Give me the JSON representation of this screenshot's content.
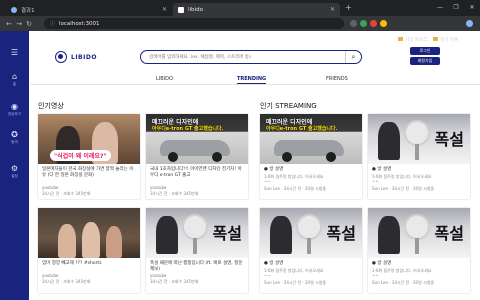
{
  "browser": {
    "tabs": [
      {
        "label": "결과1",
        "active": false
      },
      {
        "label": "libido",
        "active": true
      }
    ],
    "url": "localhost:3001",
    "bookmarks": [
      "기타 북마크",
      "읽기 목록"
    ]
  },
  "header": {
    "logo": "LIBIDO",
    "search_placeholder": "검색어를 입력하세요. (ex. 채널명, 제목, 스트리머 등)",
    "login_label": "로그인",
    "signup_label": "회원가입"
  },
  "sidebar": {
    "items": [
      {
        "icon": "menu-icon",
        "label": ""
      },
      {
        "icon": "home-icon",
        "label": "홈"
      },
      {
        "icon": "broadcast-icon",
        "label": "방송하기"
      },
      {
        "icon": "explore-icon",
        "label": "탐색"
      },
      {
        "icon": "settings-icon",
        "label": "설정"
      }
    ]
  },
  "nav": {
    "tabs": [
      {
        "label": "LIBIDO",
        "active": false
      },
      {
        "label": "TRENDING",
        "active": true
      },
      {
        "label": "FRIENDS",
        "active": false
      }
    ]
  },
  "sections": {
    "videos_title": "인기영상",
    "streaming_title": "인기 STREAMING"
  },
  "videos": [
    {
      "title": "일본여자들이 한국 화장실에 가면 깜짝 놀라는 이유 (다 한 일본 화장실 문화)",
      "channel": "youtube",
      "meta": "34시간 전 · 조회수 345만회",
      "caption": "\"식겁이 왜 이래요?\""
    },
    {
      "title": "국내 1호차입니다!!! 아이언맨 디자인 전기차! 아우디 e-tron GT 출고",
      "channel": "youtube",
      "meta": "34시간 전 · 조회수 345만회",
      "caption1": "매끄러운 디자인에",
      "caption2": "아우디e-tron GT 출고했습니다."
    },
    {
      "title": "엄마 청양 빼고해 ??? #shorts",
      "channel": "youtube",
      "meta": "34시간 전 · 조회수 345만회"
    },
    {
      "title": "폭설 때문에 떠난 캠핑입니다 (ft. 애로 설명, 질문 제보)",
      "channel": "youtube",
      "meta": "34시간 전 · 조회수 345만회",
      "caption": "폭설"
    }
  ],
  "streams": [
    {
      "title": "● 방 설명",
      "desc": "1-6화 점주랑 방입니다. 어서오세요^^",
      "meta": "Sun Lee · 34시간 전 · 20명 시청중",
      "caption1": "매끄러운 디자인에",
      "caption2": "아우디e-tron GT 출고했습니다."
    },
    {
      "title": "● 방 설명",
      "desc": "1-6화 점주랑 방입니다. 어서오세요^^",
      "meta": "Sun Lee · 34시간 전 · 20명 시청중",
      "caption": "폭설"
    },
    {
      "title": "● 방 설명",
      "desc": "1-6화 점주랑 방입니다. 어서오세요^^",
      "meta": "Sun Lee · 34시간 전 · 20명 시청중",
      "caption": "폭설"
    },
    {
      "title": "● 방 설명",
      "desc": "1-6화 점주랑 방입니다. 어서오세요^^",
      "meta": "Sun Lee · 34시간 전 · 20명 시청중",
      "caption": "폭설"
    }
  ],
  "colors": {
    "brand": "#1a237e",
    "chrome_dark": "#202124",
    "chrome_tab": "#35363a"
  }
}
